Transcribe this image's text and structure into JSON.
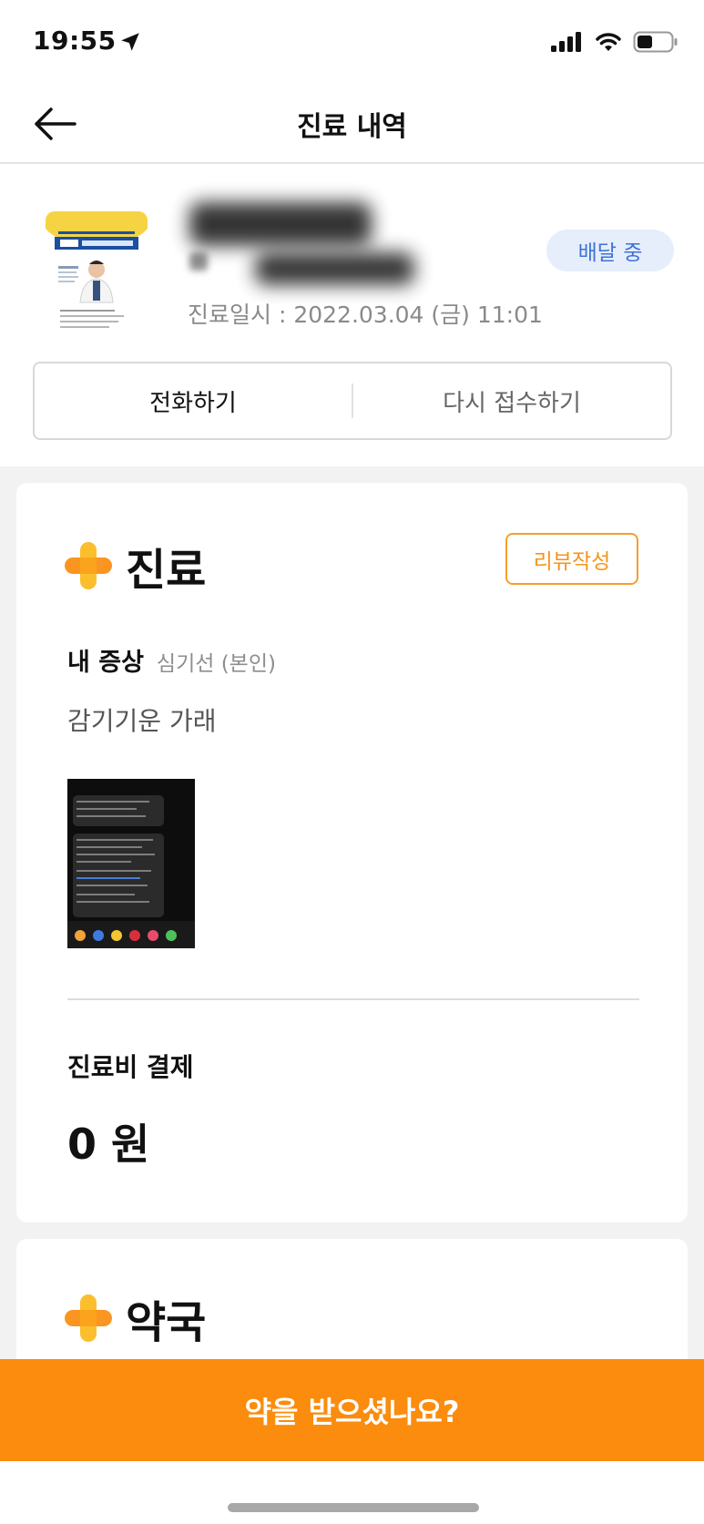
{
  "status_bar": {
    "time": "19:55",
    "icons": [
      "location-arrow-icon",
      "cellular-signal-icon",
      "wifi-icon",
      "battery-icon"
    ]
  },
  "nav": {
    "title": "진료 내역",
    "back_icon": "arrow-left-icon"
  },
  "hospital": {
    "status_badge": "배달 중",
    "visit_datetime": "진료일시 : 2022.03.04 (금) 11:01",
    "actions": {
      "call_label": "전화하기",
      "reapply_label": "다시 접수하기"
    }
  },
  "treatment_card": {
    "title": "진료",
    "review_button": "리뷰작성",
    "symptom_label": "내 증상",
    "patient": "심기선 (본인)",
    "symptom_text": "감기기운 가래",
    "fee_label": "진료비 결제",
    "fee_amount": "0 원"
  },
  "pharmacy_card": {
    "title": "약국"
  },
  "cta": {
    "label": "약을 받으셨나요?"
  },
  "colors": {
    "accent_orange": "#fb8c0e",
    "review_orange": "#f5941d",
    "badge_bg": "#e6eefc",
    "badge_text": "#3f72d6",
    "section_bg": "#f2f2f2"
  }
}
